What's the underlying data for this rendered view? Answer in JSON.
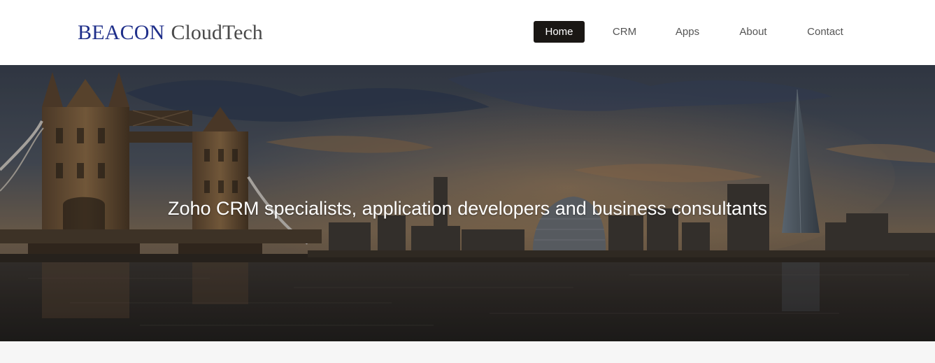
{
  "header": {
    "logo": {
      "brand": "BEACON",
      "suffix": "CloudTech"
    },
    "nav": [
      {
        "label": "Home",
        "active": true
      },
      {
        "label": "CRM",
        "active": false
      },
      {
        "label": "Apps",
        "active": false
      },
      {
        "label": "About",
        "active": false
      },
      {
        "label": "Contact",
        "active": false
      }
    ]
  },
  "hero": {
    "tagline": "Zoho CRM specialists, application developers and business consultants"
  },
  "colors": {
    "brand_blue": "#1f2f8a",
    "nav_active_bg": "#1a1714",
    "nav_text": "#555555",
    "page_bg": "#f6f6f6"
  }
}
